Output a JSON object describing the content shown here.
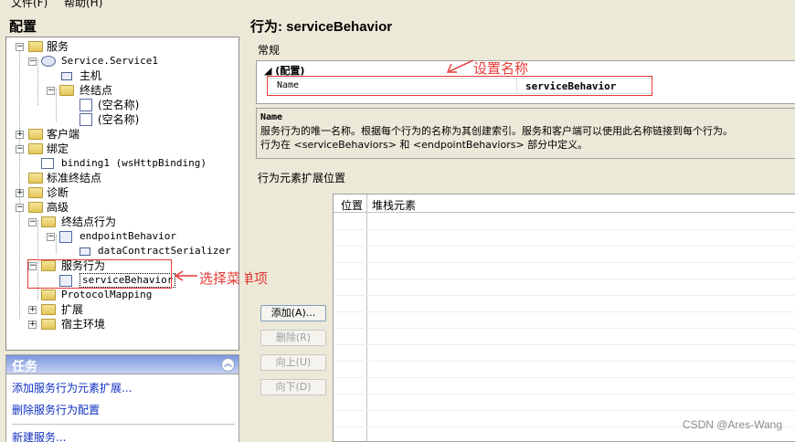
{
  "menu": {
    "file": "文件(F)",
    "help": "帮助(H)"
  },
  "left": {
    "header": "配置",
    "tree": {
      "services": "服务",
      "service1": "Service.Service1",
      "host": "主机",
      "endpoints": "终结点",
      "empty1": "(空名称)",
      "empty2": "(空名称)",
      "client": "客户端",
      "bindings": "绑定",
      "binding1": "binding1 (wsHttpBinding)",
      "std_endpoints": "标准终结点",
      "diagnostics": "诊断",
      "advanced": "高级",
      "endpoint_behaviors": "终结点行为",
      "endpoint_behavior": "endpointBehavior",
      "dcs": "dataContractSerializer",
      "service_behaviors": "服务行为",
      "service_behavior": "serviceBehavior",
      "protocol_mapping": "ProtocolMapping",
      "extensions": "扩展",
      "hosting": "宿主环境"
    }
  },
  "tasks": {
    "header": "任务",
    "links": [
      "添加服务行为元素扩展...",
      "删除服务行为配置",
      "新建服务..."
    ]
  },
  "right": {
    "title": "行为: serviceBehavior",
    "general_label": "常规",
    "group": "(配置)",
    "prop_name": "Name",
    "prop_value": "serviceBehavior",
    "desc_title": "Name",
    "desc_line1": "服务行为的唯一名称。根据每个行为的名称为其创建索引。服务和客户端可以使用此名称链接到每个行为。",
    "desc_line2": "行为在 <serviceBehaviors> 和 <endpointBehaviors> 部分中定义。",
    "ext_label": "行为元素扩展位置",
    "col_position": "位置",
    "col_stack": "堆栈元素",
    "buttons": {
      "add": "添加(A)...",
      "remove": "删除(R)",
      "up": "向上(U)",
      "down": "向下(D)"
    }
  },
  "annotations": {
    "set_name": "设置名称",
    "select_item": "选择菜单项"
  },
  "watermark": "CSDN @Ares-Wang",
  "colors": {
    "annotation": "#e53935",
    "background": "#ece9d8",
    "task_header": "#7a96df"
  }
}
